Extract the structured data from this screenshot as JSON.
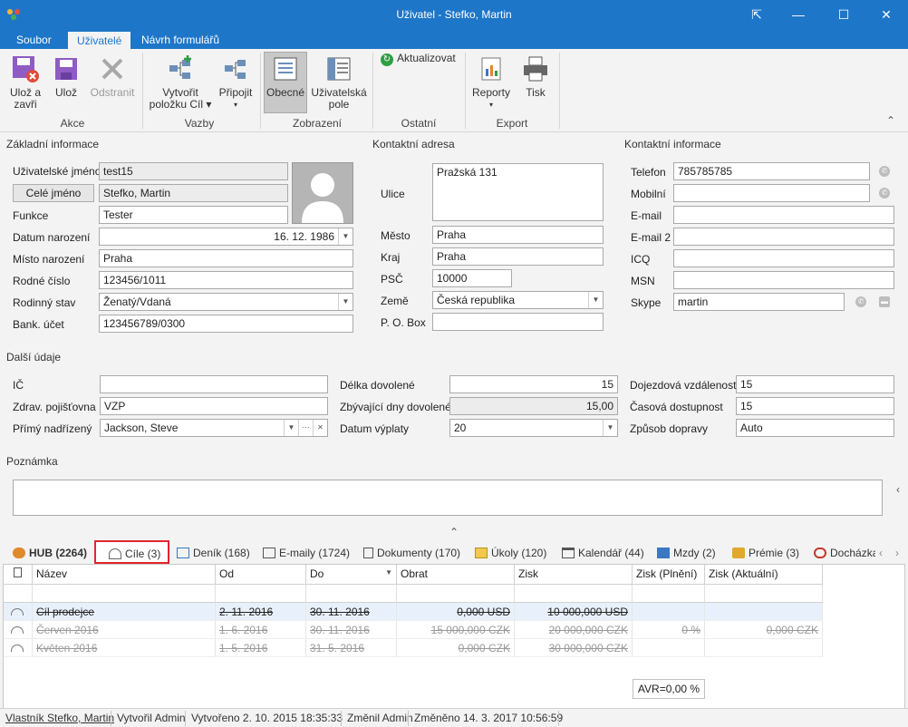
{
  "window": {
    "title": "Uživatel - Stefko, Martin",
    "controls": {
      "pin": "⇱",
      "minimize": "—",
      "maximize": "☐",
      "close": "✕"
    }
  },
  "menu": {
    "tabs": [
      "Soubor",
      "Uživatelé",
      "Návrh formulářů"
    ],
    "active": "Uživatelé"
  },
  "ribbon": {
    "buttons": {
      "save_close": [
        "Ulož a",
        "zavři"
      ],
      "save": "Ulož",
      "delete": "Odstranit",
      "create_item": [
        "Vytvořit",
        "položku Cíl ▾"
      ],
      "attach": [
        "Připojit",
        "▾"
      ],
      "general": "Obecné",
      "user_fields": [
        "Uživatelská",
        "pole"
      ],
      "refresh": "Aktualizovat",
      "reports": [
        "Reporty",
        "▾"
      ],
      "print": "Tisk"
    },
    "groups": {
      "actions": "Akce",
      "links": "Vazby",
      "view": "Zobrazení",
      "other": "Ostatní",
      "export": "Export"
    },
    "collapse": "⌃"
  },
  "basic": {
    "title": "Základní informace",
    "username_label": "Uživatelské jméno",
    "username": "test15",
    "fullname_button": "Celé jméno",
    "fullname": "Stefko, Martin",
    "function_label": "Funkce",
    "function": "Tester",
    "birthdate_label": "Datum narození",
    "birthdate": "16. 12. 1986",
    "birthplace_label": "Místo narození",
    "birthplace": "Praha",
    "id_label": "Rodné číslo",
    "id": "123456/1011",
    "marital_label": "Rodinný stav",
    "marital": "Ženatý/Vdaná",
    "bank_label": "Bank. účet",
    "bank": "123456789/0300"
  },
  "address": {
    "title": "Kontaktní adresa",
    "street_label": "Ulice",
    "street": "Pražská 131",
    "city_label": "Město",
    "city": "Praha",
    "region_label": "Kraj",
    "region": "Praha",
    "zip_label": "PSČ",
    "zip": "10000",
    "country_label": "Země",
    "country": "Česká republika",
    "pobox_label": "P. O. Box",
    "pobox": ""
  },
  "contact": {
    "title": "Kontaktní informace",
    "phone_label": "Telefon",
    "phone": "785785785",
    "mobile_label": "Mobilní",
    "mobile": "",
    "email_label": "E-mail",
    "email": "",
    "email2_label": "E-mail 2",
    "email2": "",
    "icq_label": "ICQ",
    "icq": "",
    "msn_label": "MSN",
    "msn": "",
    "skype_label": "Skype",
    "skype": "martin"
  },
  "other": {
    "title": "Další údaje",
    "ic_label": "IČ",
    "ic": "",
    "insurance_label": "Zdrav. pojišťovna",
    "insurance": "VZP",
    "manager_label": "Přímý nadřízený",
    "manager": "Jackson, Steve",
    "vacation_label": "Délka dovolené",
    "vacation": "15",
    "vacation_left_label": "Zbývající dny dovolené",
    "vacation_left": "15,00",
    "payday_label": "Datum výplaty",
    "payday": "20",
    "commute_label": "Dojezdová vzdálenost",
    "commute": "15",
    "availability_label": "Časová dostupnost",
    "availability": "15",
    "transport_label": "Způsob dopravy",
    "transport": "Auto"
  },
  "note": {
    "title": "Poznámka",
    "value": ""
  },
  "tabs": [
    {
      "label": "HUB (2264)",
      "bold": true
    },
    {
      "label": "Cíle (3)",
      "active": true
    },
    {
      "label": "Deník (168)"
    },
    {
      "label": "E-maily (1724)"
    },
    {
      "label": "Dokumenty (170)"
    },
    {
      "label": "Úkoly (120)"
    },
    {
      "label": "Kalendář (44)"
    },
    {
      "label": "Mzdy (2)"
    },
    {
      "label": "Prémie (3)"
    },
    {
      "label": "Docházka"
    }
  ],
  "grid": {
    "columns": [
      "Název",
      "Od",
      "Do",
      "Obrat",
      "Zisk",
      "Zisk (Plnění)",
      "Zisk (Aktuální)"
    ],
    "sort_indicator": "▼",
    "rows": [
      {
        "name": "Cíl prodejce",
        "from": "2. 11. 2016",
        "to": "30. 11. 2016",
        "turnover": "0,000 USD",
        "profit": "10 000,000 USD",
        "profit_fulfil": "",
        "profit_actual": "",
        "dim": false
      },
      {
        "name": "Červen 2016",
        "from": "1. 6. 2016",
        "to": "30. 11. 2016",
        "turnover": "15 000,000 CZK",
        "profit": "20 000,000 CZK",
        "profit_fulfil": "0 %",
        "profit_actual": "0,000 CZK",
        "dim": true
      },
      {
        "name": "Květen 2016",
        "from": "1. 5. 2016",
        "to": "31. 5. 2016",
        "turnover": "0,000 CZK",
        "profit": "30 000,000 CZK",
        "profit_fulfil": "",
        "profit_actual": "",
        "dim": true
      }
    ],
    "summary": "AVR=0,00 %"
  },
  "status": {
    "owner": "Vlastník Stefko, Martin",
    "created_by": "Vytvořil Admin",
    "created": "Vytvořeno 2. 10. 2015 18:35:33",
    "changed_by": "Změnil Admin",
    "changed": "Změněno 14. 3. 2017 10:56:59"
  },
  "colors": {
    "accent": "#1e76c8",
    "highlight": "#e8f1fb",
    "tab_highlight": "#e0262f"
  }
}
